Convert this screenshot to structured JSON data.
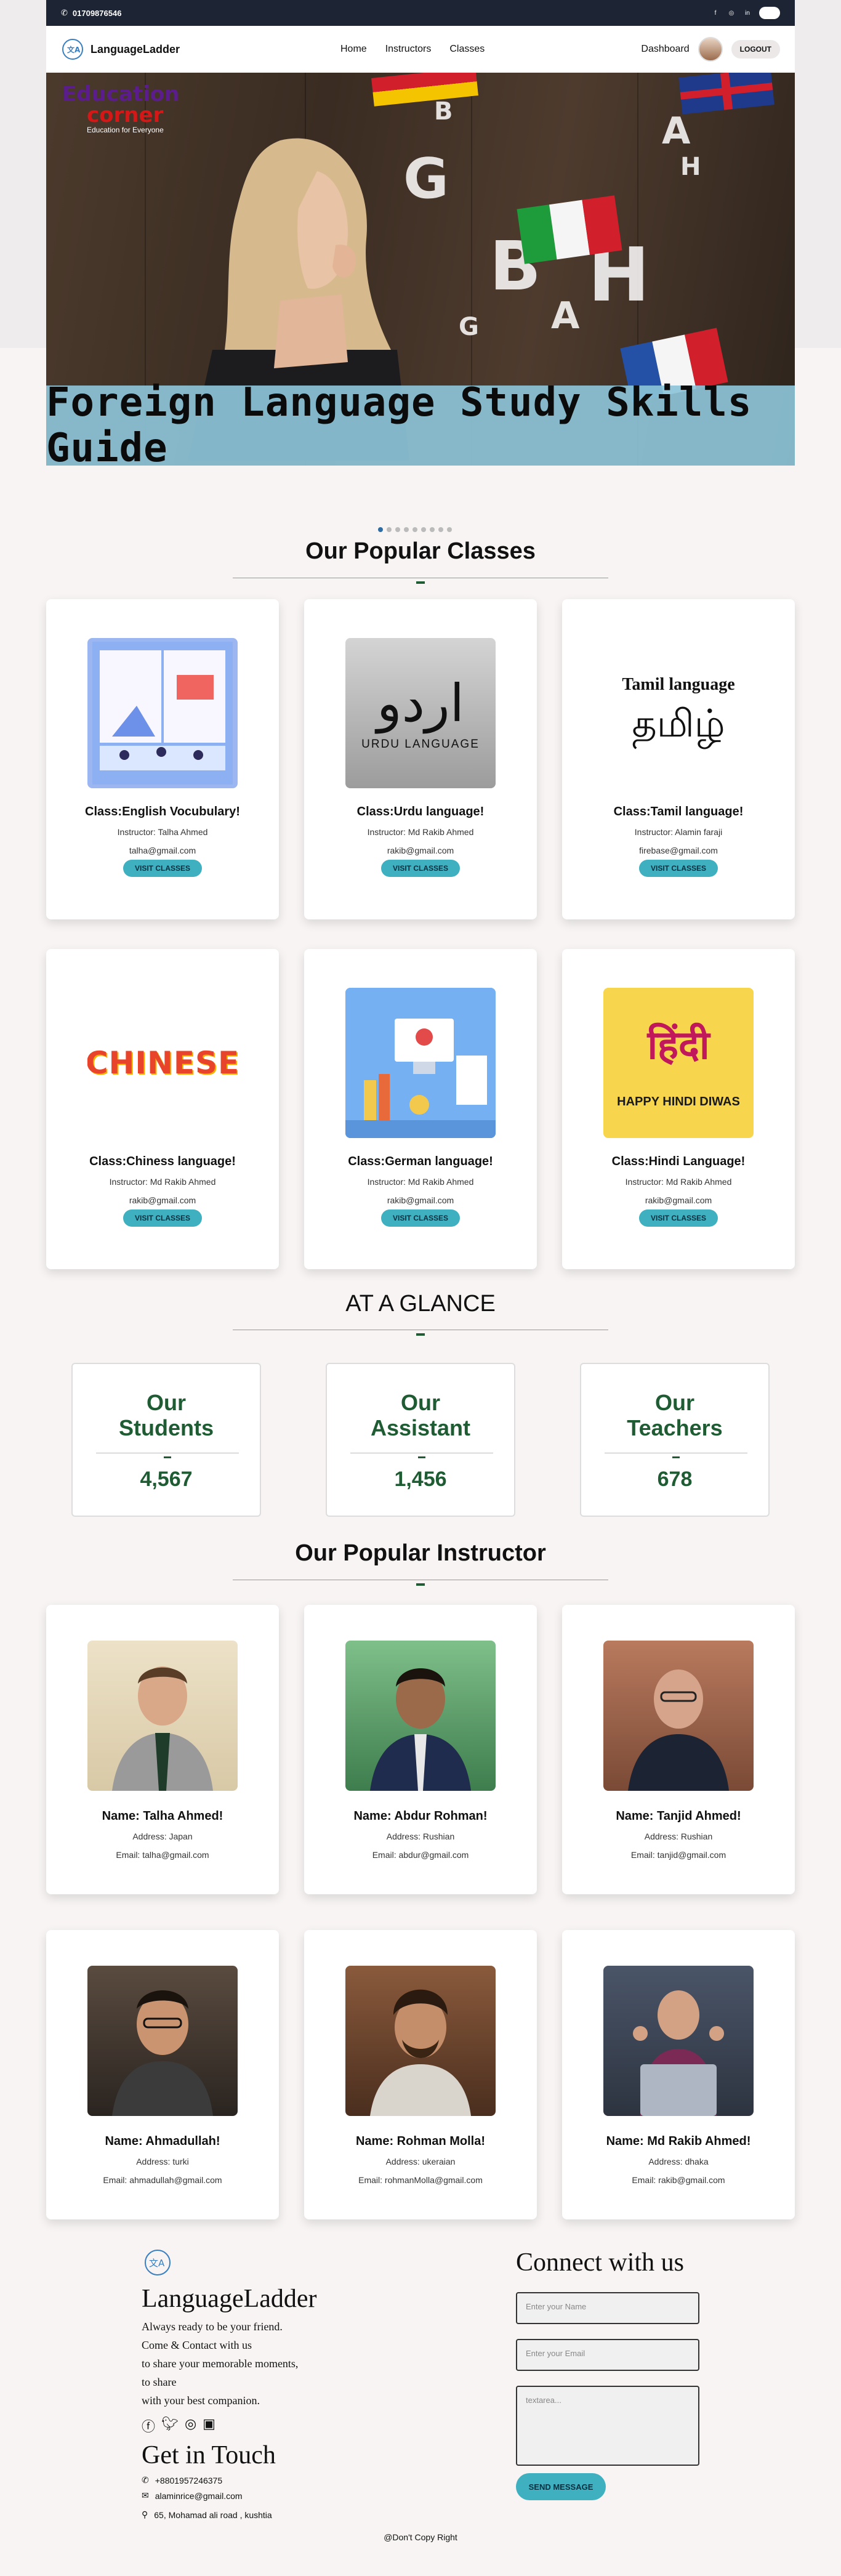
{
  "topbar": {
    "phone": "01709876546"
  },
  "nav": {
    "brand": "LanguageLadder",
    "menu": [
      "Home",
      "Instructors",
      "Classes"
    ],
    "dashboard": "Dashboard",
    "logout": "LOGOUT"
  },
  "hero": {
    "logo_line1": "Education",
    "logo_line2": "corner",
    "logo_tag": "Education for Everyone",
    "banner_title": "Foreign Language Study Skills Guide"
  },
  "popular_classes": {
    "title": "Our Popular Classes",
    "button_label": "VISIT CLASSES",
    "items": [
      {
        "title": "Class:English Vocubulary!",
        "instructor": "Instructor: Talha Ahmed",
        "email": "talha@gmail.com",
        "thumb_text": ""
      },
      {
        "title": "Class:Urdu language!",
        "instructor": "Instructor: Md Rakib Ahmed",
        "email": "rakib@gmail.com",
        "thumb_text": "اردو",
        "thumb_sub": "URDU LANGUAGE"
      },
      {
        "title": "Class:Tamil language!",
        "instructor": "Instructor: Alamin faraji",
        "email": "firebase@gmail.com",
        "thumb_text": "தமிழ்",
        "thumb_sub": "Tamil language"
      },
      {
        "title": "Class:Chiness language!",
        "instructor": "Instructor: Md Rakib Ahmed",
        "email": "rakib@gmail.com",
        "thumb_text": "CHINESE"
      },
      {
        "title": "Class:German language!",
        "instructor": "Instructor: Md Rakib Ahmed",
        "email": "rakib@gmail.com",
        "thumb_text": ""
      },
      {
        "title": "Class:Hindi Language!",
        "instructor": "Instructor: Md Rakib Ahmed",
        "email": "rakib@gmail.com",
        "thumb_text": "हिंदी",
        "thumb_sub": "HAPPY HINDI DIWAS"
      }
    ]
  },
  "glance": {
    "title": "AT A GLANCE",
    "stats": [
      {
        "line1": "Our",
        "line2": "Students",
        "value": "4,567"
      },
      {
        "line1": "Our",
        "line2": "Assistant",
        "value": "1,456"
      },
      {
        "line1": "Our",
        "line2": "Teachers",
        "value": "678"
      }
    ]
  },
  "instructors": {
    "title": "Our Popular Instructor",
    "items": [
      {
        "name": "Name: Talha Ahmed!",
        "address": "Address: Japan",
        "email": "Email: talha@gmail.com"
      },
      {
        "name": "Name: Abdur Rohman!",
        "address": "Address: Rushian",
        "email": "Email: abdur@gmail.com"
      },
      {
        "name": "Name: Tanjid Ahmed!",
        "address": "Address: Rushian",
        "email": "Email: tanjid@gmail.com"
      },
      {
        "name": "Name: Ahmadullah!",
        "address": "Address: turki",
        "email": "Email: ahmadullah@gmail.com"
      },
      {
        "name": "Name: Rohman Molla!",
        "address": "Address: ukeraian",
        "email": "Email: rohmanMolla@gmail.com"
      },
      {
        "name": "Name: Md Rakib Ahmed!",
        "address": "Address: dhaka",
        "email": "Email: rakib@gmail.com"
      }
    ]
  },
  "footer": {
    "brand": "LanguageLadder",
    "tagline": [
      "Always ready to be your friend.",
      "Come & Contact with us",
      "to share your memorable moments,",
      "to share",
      "with your best companion."
    ],
    "get_in_touch": "Get in Touch",
    "phone": "+8801957246375",
    "email": "alaminrice@gmail.com",
    "address": "65, Mohamad ali road , kushtia",
    "connect_title": "Connect with us",
    "name_placeholder": "Enter your Name",
    "email_placeholder": "Enter your Email",
    "message_placeholder": "textarea...",
    "send_label": "SEND MESSAGE",
    "copyright": "@Don't Copy Right"
  }
}
